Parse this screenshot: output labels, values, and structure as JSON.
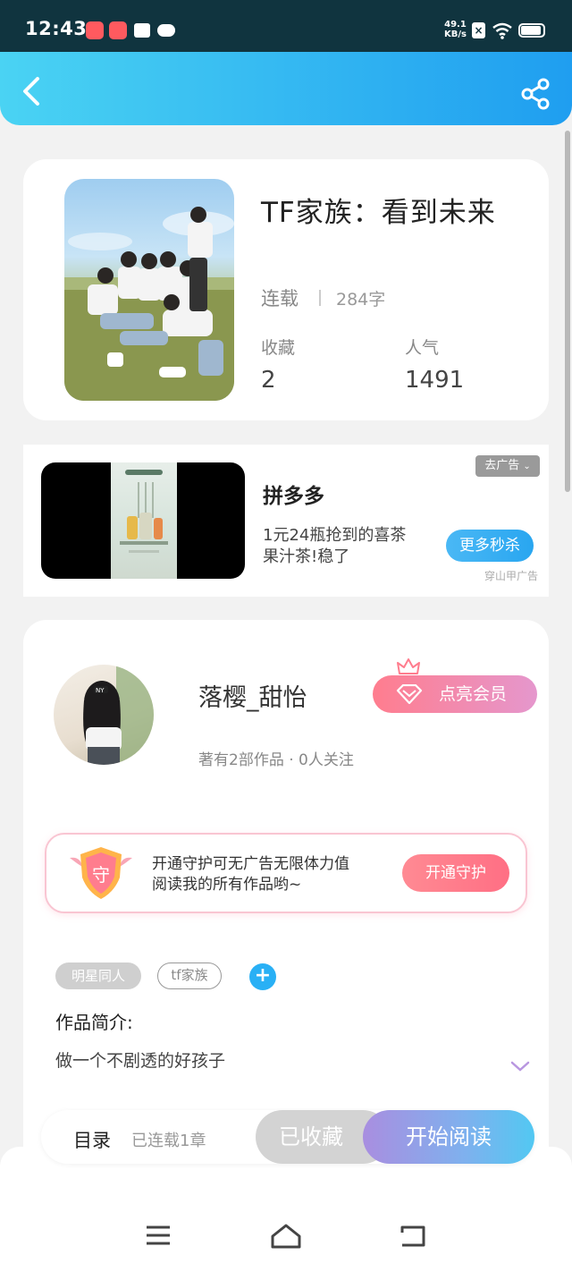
{
  "status_bar": {
    "time": "12:43",
    "net_speed_value": "49.1",
    "net_speed_unit": "KB/s",
    "icons": [
      "app-icon",
      "app-icon",
      "notification-icon",
      "cloud-icon",
      "no-sim-icon",
      "wifi-icon",
      "battery-icon"
    ]
  },
  "header": {
    "back_icon": "chevron-left-icon",
    "share_icon": "share-icon"
  },
  "book": {
    "title": "TF家族：看到未来",
    "status": "连载",
    "word_count": "284字",
    "favorites_label": "收藏",
    "favorites_value": "2",
    "popularity_label": "人气",
    "popularity_value": "1491"
  },
  "ad": {
    "close_label": "去广告",
    "title": "拼多多",
    "description": "1元24瓶抢到的喜茶果汁茶!稳了",
    "button_label": "更多秒杀",
    "source": "穿山甲广告"
  },
  "author": {
    "name": "落樱_甜怡",
    "meta": "著有2部作品 · 0人关注",
    "vip_button_label": "点亮会员"
  },
  "guard": {
    "badge_char": "守",
    "text_line1": "开通守护可无广告无限体力值",
    "text_line2": "阅读我的所有作品哟~",
    "button_label": "开通守护"
  },
  "tags": [
    "明星同人",
    "tf家族"
  ],
  "intro": {
    "label": "作品简介:",
    "text": "做一个不剧透的好孩子"
  },
  "action_bar": {
    "toc_label": "目录",
    "toc_status": "已连载1章",
    "collected_label": "已收藏",
    "read_label": "开始阅读"
  },
  "colors": {
    "header_start": "#4ad3f3",
    "header_end": "#1f9ef0",
    "accent_blue": "#29b0f5",
    "guard_pink": "#ff6f84"
  }
}
